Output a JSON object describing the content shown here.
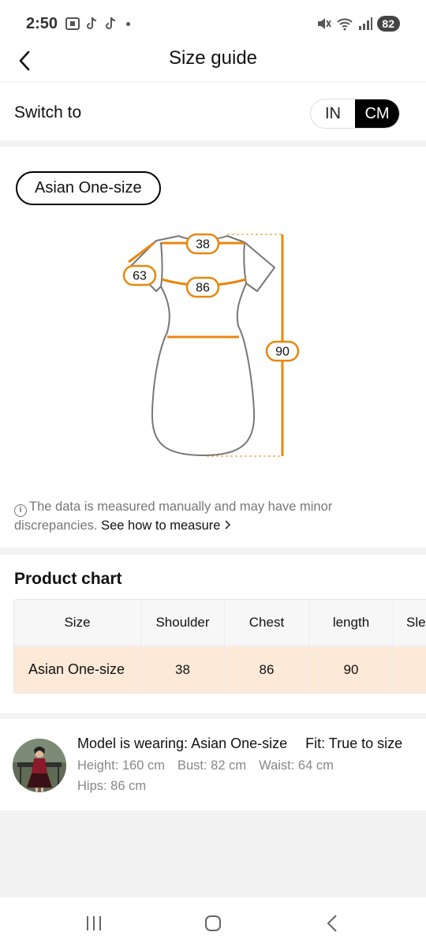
{
  "status_bar": {
    "time": "2:50",
    "battery": "82"
  },
  "header": {
    "title": "Size guide"
  },
  "unit_switch": {
    "label": "Switch to",
    "options": [
      "IN",
      "CM"
    ],
    "selected": "CM"
  },
  "size_chip": "Asian One-size",
  "diagram": {
    "shoulder": "38",
    "sleeve": "63",
    "chest": "86",
    "length": "90",
    "accent_color": "#e8870e"
  },
  "note": {
    "text": "The data is measured manually and may have minor discrepancies.",
    "link": "See how to measure"
  },
  "product_chart": {
    "title": "Product chart",
    "headers": [
      "Size",
      "Shoulder",
      "Chest",
      "length",
      "Sle"
    ],
    "rows": [
      [
        "Asian One-size",
        "38",
        "86",
        "90",
        ""
      ]
    ]
  },
  "model": {
    "wearing": "Model is wearing: Asian One-size",
    "fit": "Fit: True to size",
    "height": "Height: 160 cm",
    "bust": "Bust: 82 cm",
    "waist": "Waist: 64 cm",
    "hips": "Hips: 86 cm"
  }
}
